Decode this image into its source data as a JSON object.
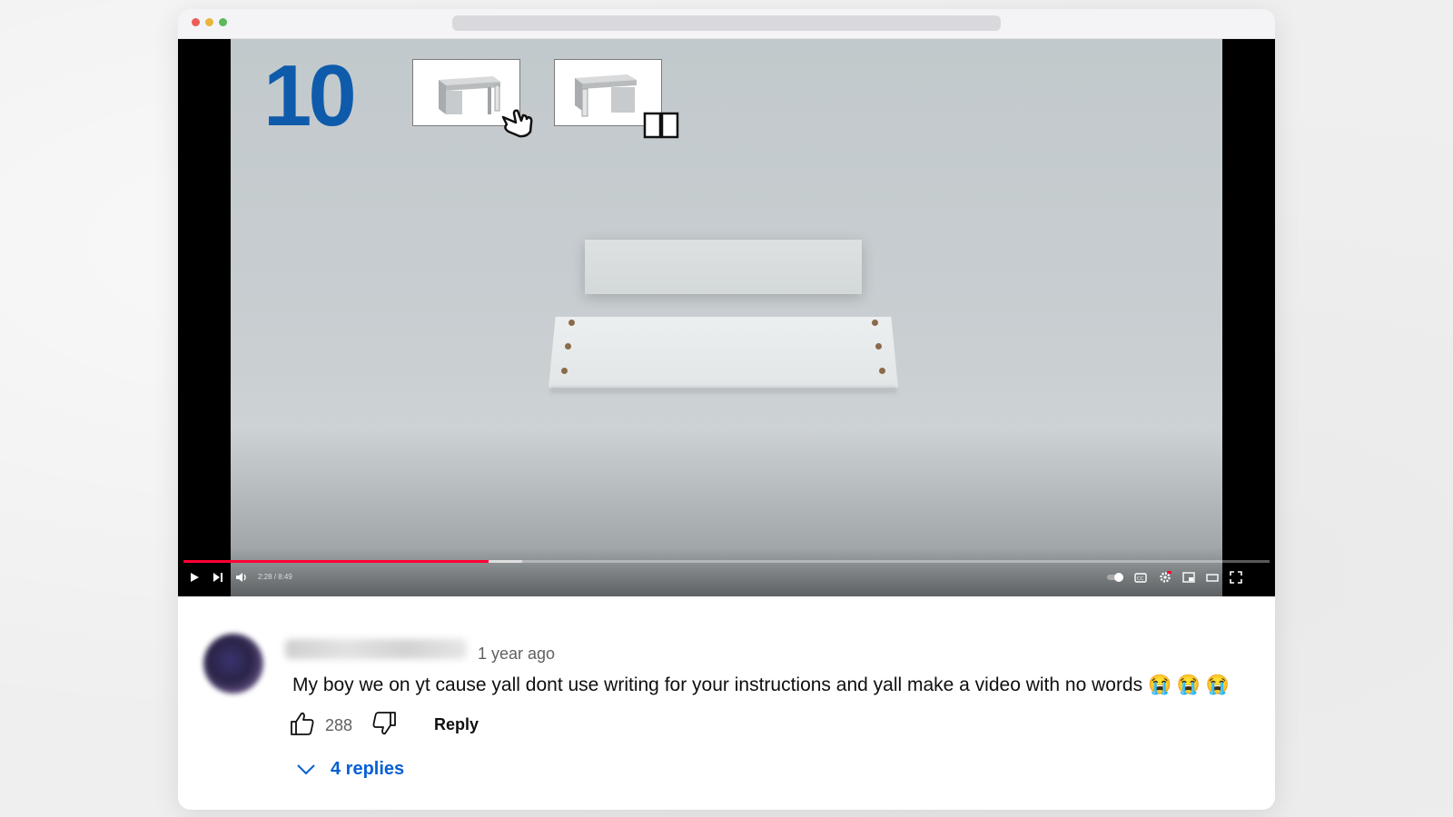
{
  "video": {
    "step_number": "10",
    "current_time": "2:28",
    "duration": "8:49",
    "time_display": "2:28 / 8:49",
    "progress_fraction": 0.281,
    "buffered_fraction": 0.312,
    "accent_color": "#ff0033"
  },
  "icons": {
    "play": "play-icon",
    "next": "next-icon",
    "volume": "volume-icon",
    "autoplay": "autoplay-toggle-icon",
    "captions": "captions-icon",
    "settings": "settings-gear-icon",
    "miniplayer": "miniplayer-icon",
    "theater": "theater-mode-icon",
    "fullscreen": "fullscreen-icon"
  },
  "comment": {
    "timestamp": "1 year ago",
    "text": "My boy we on yt cause yall dont use writing for your instructions and yall make a video with no words 😭 😭 😭",
    "like_count": "288",
    "reply_label": "Reply",
    "replies_label": "4 replies",
    "link_color": "#065fd4"
  }
}
